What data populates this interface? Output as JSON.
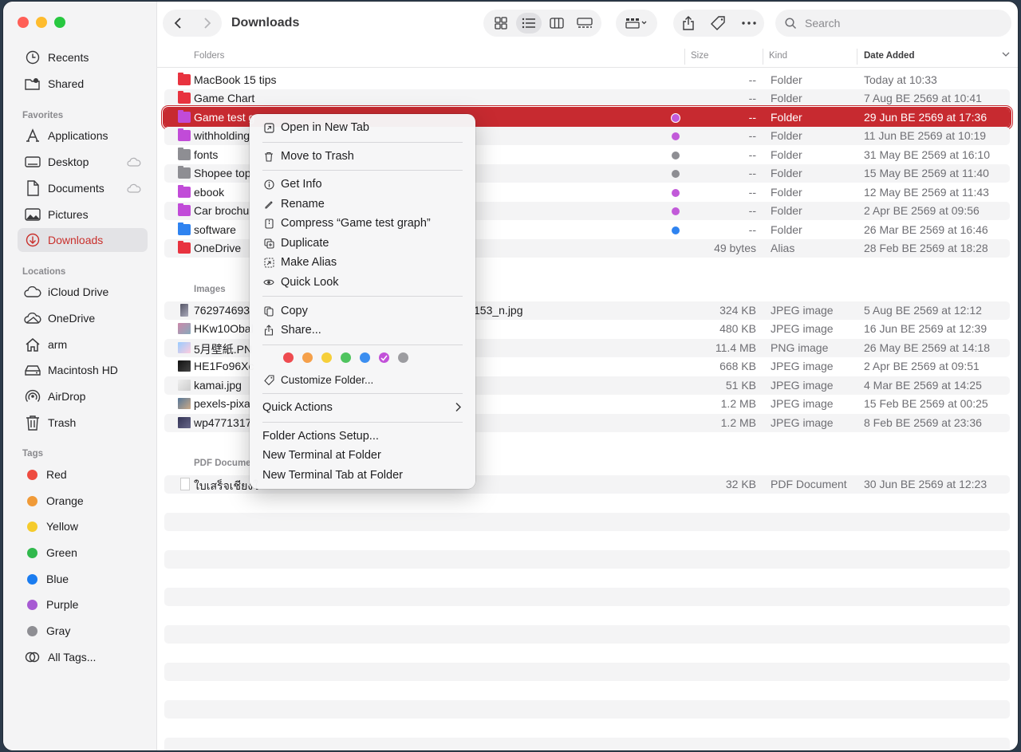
{
  "window": {
    "title": "Downloads"
  },
  "sidebar": {
    "sections": {
      "favorites": "Favorites",
      "locations": "Locations",
      "tags": "Tags"
    },
    "top": [
      {
        "label": "Recents",
        "icon": "clock-icon"
      },
      {
        "label": "Shared",
        "icon": "shared-folder-icon"
      }
    ],
    "favorites": [
      {
        "label": "Applications",
        "icon": "applications-icon"
      },
      {
        "label": "Desktop",
        "icon": "desktop-icon",
        "cloud": true
      },
      {
        "label": "Documents",
        "icon": "document-icon",
        "cloud": true
      },
      {
        "label": "Pictures",
        "icon": "pictures-icon"
      },
      {
        "label": "Downloads",
        "icon": "downloads-icon",
        "active": true
      }
    ],
    "locations": [
      {
        "label": "iCloud Drive",
        "icon": "cloud-icon"
      },
      {
        "label": "OneDrive",
        "icon": "onedrive-icon"
      },
      {
        "label": "arm",
        "icon": "home-icon"
      },
      {
        "label": "Macintosh HD",
        "icon": "disk-icon"
      },
      {
        "label": "AirDrop",
        "icon": "airdrop-icon"
      },
      {
        "label": "Trash",
        "icon": "trash-icon"
      }
    ],
    "tags": [
      {
        "label": "Red",
        "color": "#ee4b40"
      },
      {
        "label": "Orange",
        "color": "#f09a37"
      },
      {
        "label": "Yellow",
        "color": "#f5cb2c"
      },
      {
        "label": "Green",
        "color": "#31b94d"
      },
      {
        "label": "Blue",
        "color": "#1a7cf0"
      },
      {
        "label": "Purple",
        "color": "#a75ad3"
      },
      {
        "label": "Gray",
        "color": "#8e8e93"
      },
      {
        "label": "All Tags...",
        "color": ""
      }
    ]
  },
  "toolbar": {
    "search_placeholder": "Search"
  },
  "columns": {
    "name": "Folders",
    "size": "Size",
    "kind": "Kind",
    "date": "Date Added"
  },
  "groups": {
    "folders": "Folders",
    "images": "Images",
    "pdf": "PDF Docume"
  },
  "folders": [
    {
      "name": "MacBook 15 tips",
      "size": "--",
      "kind": "Folder",
      "date": "Today at 10:33",
      "color": "#e8333f",
      "tag": ""
    },
    {
      "name": "Game Chart",
      "size": "--",
      "kind": "Folder",
      "date": "7 Aug BE 2569 at 10:41",
      "color": "#e8333f",
      "tag": ""
    },
    {
      "name": "Game test g",
      "size": "--",
      "kind": "Folder",
      "date": "29 Jun BE 2569 at 17:36",
      "color": "#c14bd8",
      "tag": "#c25ad9",
      "selected": true
    },
    {
      "name": "withholding",
      "size": "--",
      "kind": "Folder",
      "date": "11 Jun BE 2569 at 10:19",
      "color": "#c14bd8",
      "tag": "#c25ad9"
    },
    {
      "name": "fonts",
      "size": "--",
      "kind": "Folder",
      "date": "31 May BE 2569 at 16:10",
      "color": "#8e8e93",
      "tag": "#8e8e93"
    },
    {
      "name": "Shopee top",
      "size": "--",
      "kind": "Folder",
      "date": "15 May BE 2569 at 11:40",
      "color": "#8e8e93",
      "tag": "#8e8e93"
    },
    {
      "name": "ebook",
      "size": "--",
      "kind": "Folder",
      "date": "12 May BE 2569 at 11:43",
      "color": "#c14bd8",
      "tag": "#c25ad9"
    },
    {
      "name": "Car brochu",
      "size": "--",
      "kind": "Folder",
      "date": "2 Apr BE 2569 at 09:56",
      "color": "#c14bd8",
      "tag": "#c25ad9"
    },
    {
      "name": "software",
      "size": "--",
      "kind": "Folder",
      "date": "26 Mar BE 2569 at 16:46",
      "color": "#2f83f0",
      "tag": "#2f83f0"
    },
    {
      "name": "OneDrive",
      "size": "49 bytes",
      "kind": "Alias",
      "date": "28 Feb BE 2569 at 18:28",
      "color": "#e8333f",
      "tag": ""
    }
  ],
  "images": [
    {
      "name": "762974693",
      "suffix": "153_n.jpg",
      "size": "324 KB",
      "kind": "JPEG image",
      "date": "5 Aug BE 2569 at 12:12"
    },
    {
      "name": "HKw10Obal",
      "size": "480 KB",
      "kind": "JPEG image",
      "date": "16 Jun BE 2569 at 12:39"
    },
    {
      "name": "5月壁紙.PN",
      "size": "11.4 MB",
      "kind": "PNG image",
      "date": "26 May BE 2569 at 14:18"
    },
    {
      "name": "HE1Fo96Xc",
      "size": "668 KB",
      "kind": "JPEG image",
      "date": "2 Apr BE 2569 at 09:51"
    },
    {
      "name": "kamai.jpg",
      "size": "51 KB",
      "kind": "JPEG image",
      "date": "4 Mar BE 2569 at 14:25"
    },
    {
      "name": "pexels-pixa",
      "size": "1.2 MB",
      "kind": "JPEG image",
      "date": "15 Feb BE 2569 at 00:25"
    },
    {
      "name": "wp4771317",
      "size": "1.2 MB",
      "kind": "JPEG image",
      "date": "8 Feb BE 2569 at 23:36"
    }
  ],
  "pdfs": [
    {
      "name": "ใบเสร็จเชียงใ",
      "size": "32 KB",
      "kind": "PDF Document",
      "date": "30 Jun BE 2569 at 12:23"
    }
  ],
  "context_menu": {
    "open_new_tab": "Open in New Tab",
    "move_to_trash": "Move to Trash",
    "get_info": "Get Info",
    "rename": "Rename",
    "compress": "Compress “Game test graph”",
    "duplicate": "Duplicate",
    "make_alias": "Make Alias",
    "quick_look": "Quick Look",
    "copy": "Copy",
    "share": "Share...",
    "tag_colors": [
      "#ee4b50",
      "#f5a04a",
      "#f6cf3a",
      "#4fc45f",
      "#3b8ef0",
      "#c251d9",
      "#9c9ca0"
    ],
    "selected_tag_index": 5,
    "customize_folder": "Customize Folder...",
    "quick_actions": "Quick Actions",
    "folder_actions_setup": "Folder Actions Setup...",
    "new_terminal": "New Terminal at Folder",
    "new_terminal_tab": "New Terminal Tab at Folder"
  }
}
